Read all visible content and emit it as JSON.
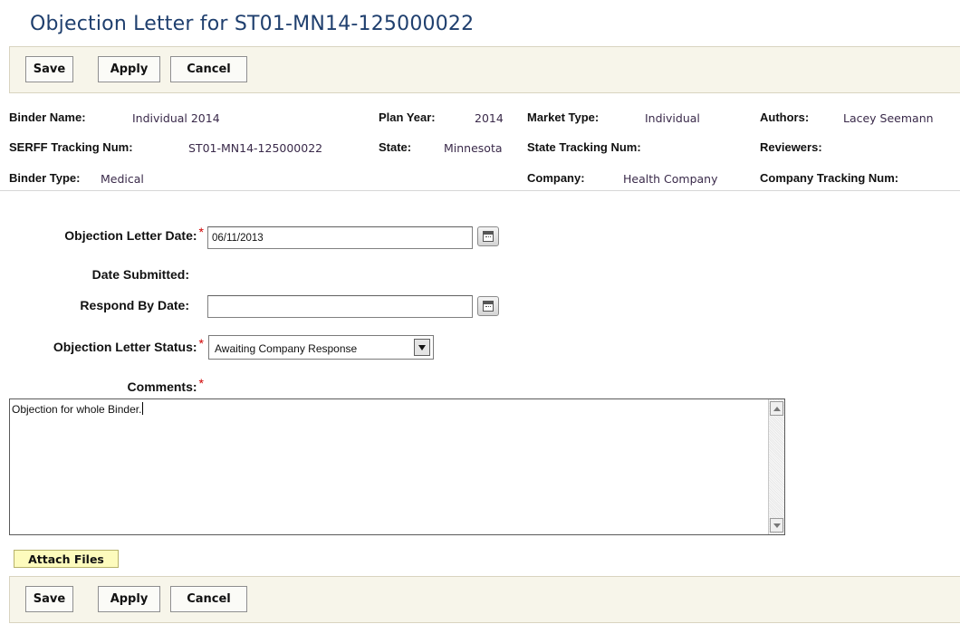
{
  "page": {
    "title": "Objection Letter for ST01-MN14-125000022"
  },
  "toolbar": {
    "save_label": "Save",
    "apply_label": "Apply",
    "cancel_label": "Cancel"
  },
  "binder_info": {
    "binder_name": {
      "label": "Binder Name:",
      "value": "Individual 2014"
    },
    "serff_tracking_num": {
      "label": "SERFF Tracking Num:",
      "value": "ST01-MN14-125000022"
    },
    "binder_type": {
      "label": "Binder Type:",
      "value": "Medical"
    },
    "plan_year": {
      "label": "Plan Year:",
      "value": "2014"
    },
    "state": {
      "label": "State:",
      "value": "Minnesota"
    },
    "market_type": {
      "label": "Market Type:",
      "value": "Individual"
    },
    "state_tracking_num": {
      "label": "State Tracking Num:",
      "value": ""
    },
    "company": {
      "label": "Company:",
      "value": "Health Company"
    },
    "authors": {
      "label": "Authors:",
      "value": "Lacey Seemann"
    },
    "reviewers": {
      "label": "Reviewers:",
      "value": ""
    },
    "company_tracking_num": {
      "label": "Company Tracking Num:",
      "value": ""
    }
  },
  "form": {
    "objection_letter_date": {
      "label": "Objection Letter Date:",
      "value": "06/11/2013",
      "required": true
    },
    "date_submitted": {
      "label": "Date Submitted:",
      "value": ""
    },
    "respond_by_date": {
      "label": "Respond By Date:",
      "value": ""
    },
    "objection_letter_status": {
      "label": "Objection Letter Status:",
      "value": "Awaiting Company Response",
      "required": true
    },
    "comments": {
      "label": "Comments:",
      "value": "Objection for whole Binder.",
      "required": true
    },
    "required_marker": "*"
  },
  "attach": {
    "label": "Attach Files"
  },
  "colors": {
    "title": "#1f3f6e",
    "toolbar_bg": "#f7f5ea",
    "required": "#d00000",
    "attach_bg": "#fdfbbd"
  },
  "icons": {
    "calendar": "calendar-icon",
    "dropdown": "chevron-down-icon"
  }
}
